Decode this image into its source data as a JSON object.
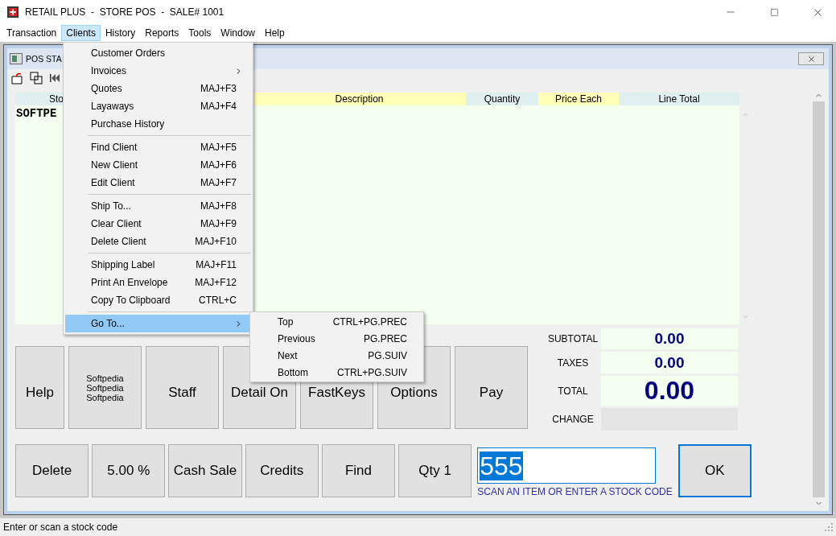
{
  "window": {
    "title": "RETAIL PLUS  -  STORE POS  -  SALE# 1001"
  },
  "menu_bar": [
    {
      "label": "Transaction",
      "selected": false
    },
    {
      "label": "Clients",
      "selected": true
    },
    {
      "label": "History",
      "selected": false
    },
    {
      "label": "Reports",
      "selected": false
    },
    {
      "label": "Tools",
      "selected": false
    },
    {
      "label": "Window",
      "selected": false
    },
    {
      "label": "Help",
      "selected": false
    }
  ],
  "clients_menu": [
    [
      {
        "label": "Customer Orders",
        "has_submenu": false,
        "selected": false
      },
      {
        "label": "Invoices",
        "has_submenu": true,
        "selected": false
      },
      {
        "label": "Quotes",
        "shortcut": "MAJ+F3",
        "has_submenu": false,
        "selected": false
      },
      {
        "label": "Layaways",
        "shortcut": "MAJ+F4",
        "has_submenu": false,
        "selected": false
      },
      {
        "label": "Purchase History",
        "has_submenu": false,
        "selected": false
      }
    ],
    [
      {
        "label": "Find Client",
        "shortcut": "MAJ+F5",
        "has_submenu": false,
        "selected": false
      },
      {
        "label": "New Client",
        "shortcut": "MAJ+F6",
        "has_submenu": false,
        "selected": false
      },
      {
        "label": "Edit Client",
        "shortcut": "MAJ+F7",
        "has_submenu": false,
        "selected": false
      }
    ],
    [
      {
        "label": "Ship To...",
        "shortcut": "MAJ+F8",
        "has_submenu": false,
        "selected": false
      },
      {
        "label": "Clear Client",
        "shortcut": "MAJ+F9",
        "has_submenu": false,
        "selected": false
      },
      {
        "label": "Delete Client",
        "shortcut": "MAJ+F10",
        "has_submenu": false,
        "selected": false
      }
    ],
    [
      {
        "label": "Shipping Label",
        "shortcut": "MAJ+F11",
        "has_submenu": false,
        "selected": false
      },
      {
        "label": "Print An Envelope",
        "shortcut": "MAJ+F12",
        "has_submenu": false,
        "selected": false
      },
      {
        "label": "Copy To Clipboard",
        "shortcut": "CTRL+C",
        "has_submenu": false,
        "selected": false
      }
    ],
    [
      {
        "label": "Go To...",
        "has_submenu": true,
        "selected": true
      }
    ]
  ],
  "go_to_submenu": [
    {
      "label": "Top",
      "shortcut": "CTRL+PG.PREC"
    },
    {
      "label": "Previous",
      "shortcut": "PG.PREC"
    },
    {
      "label": "Next",
      "shortcut": "PG.SUIV"
    },
    {
      "label": "Bottom",
      "shortcut": "CTRL+PG.SUIV"
    }
  ],
  "child_window": {
    "title": "POS STA"
  },
  "grid": {
    "columns": [
      {
        "label": "Sto",
        "highlighted": false
      },
      {
        "label": "Description",
        "highlighted": true
      },
      {
        "label": "Quantity",
        "highlighted": false
      },
      {
        "label": "Price Each",
        "highlighted": true
      },
      {
        "label": "Line Total",
        "highlighted": false
      }
    ],
    "rows": [
      [
        "SOFTPE"
      ]
    ]
  },
  "function_buttons": [
    {
      "label": "Help",
      "kind": "large"
    },
    {
      "label": "Softpedia\nSoftpedia\nSoftpedia",
      "kind": "small"
    },
    {
      "label": "Staff",
      "kind": "large"
    },
    {
      "label": "Detail On",
      "kind": "large"
    },
    {
      "label": "FastKeys",
      "kind": "large"
    },
    {
      "label": "Options",
      "kind": "large"
    },
    {
      "label": "Pay",
      "kind": "large"
    }
  ],
  "totals": [
    {
      "label": "SUBTOTAL",
      "value": "0.00",
      "large": false
    },
    {
      "label": "TAXES",
      "value": "0.00",
      "large": false
    },
    {
      "label": "TOTAL",
      "value": "0.00",
      "large": true
    },
    {
      "label": "CHANGE"
    }
  ],
  "action_buttons": [
    "Delete",
    "5.00 %",
    "Cash Sale",
    "Credits",
    "Find",
    "Qty 1"
  ],
  "scan": {
    "value": "555",
    "text_selected": true,
    "hint": "SCAN AN ITEM OR ENTER A STOCK CODE"
  },
  "ok_button": {
    "label": "OK",
    "focused": true
  },
  "status_bar": "Enter or scan a stock code"
}
